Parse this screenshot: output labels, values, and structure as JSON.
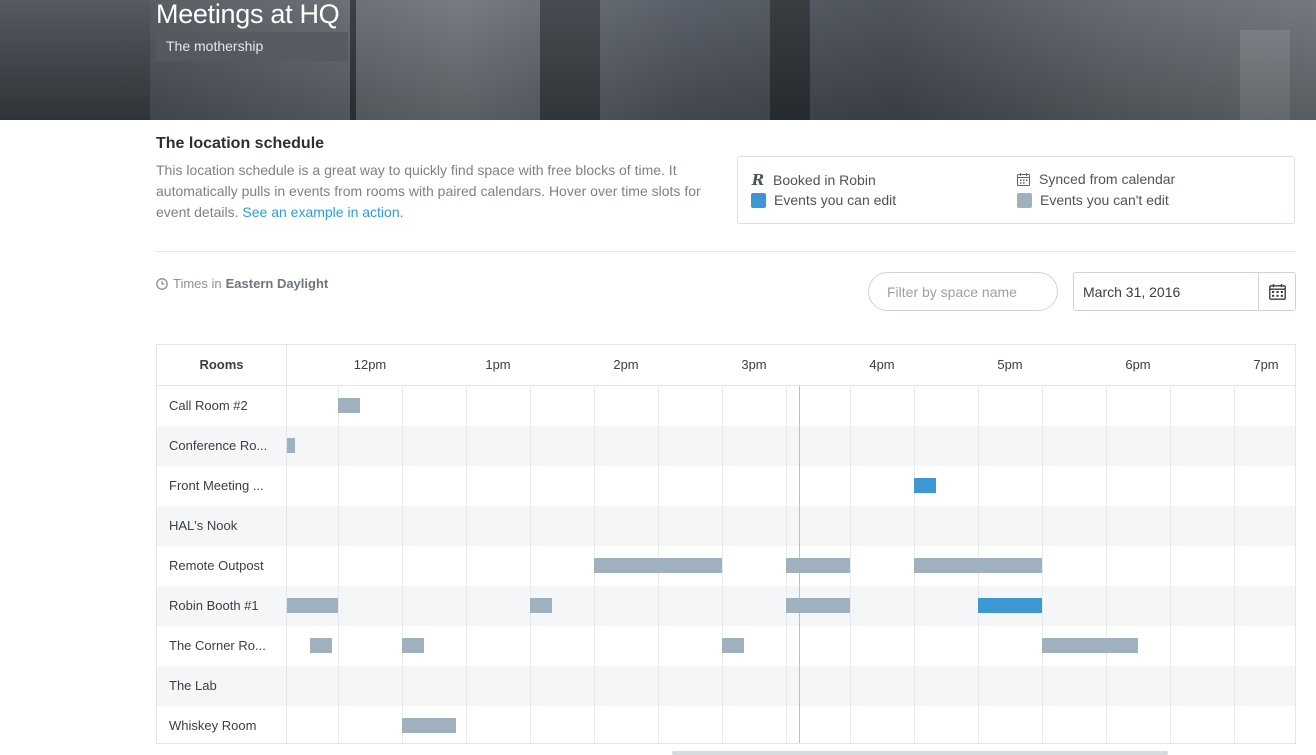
{
  "hero": {
    "title": "Meetings at HQ",
    "subtitle": "The mothership"
  },
  "intro": {
    "title": "The location schedule",
    "text": "This location schedule is a great way to quickly find space with free blocks of time. It automatically pulls in events from rooms with paired calendars. Hover over time slots for event details.",
    "link": "See an example in action."
  },
  "legend": {
    "booked": "Booked in Robin",
    "synced": "Synced from calendar",
    "editable": "Events you can edit",
    "noneditable": "Events you can't edit",
    "colors": {
      "editable": "#3d97d3",
      "noneditable": "#9fb0bf"
    }
  },
  "controls": {
    "tz_prefix": "Times in",
    "tz_name": "Eastern Daylight",
    "filter_placeholder": "Filter by space name",
    "date_value": "March 31, 2016"
  },
  "schedule": {
    "rooms_header": "Rooms",
    "start_hour": 11.6,
    "end_hour": 19.5,
    "now_hour": 15.6,
    "hours": [
      {
        "label": "12pm",
        "hour": 12
      },
      {
        "label": "1pm",
        "hour": 13
      },
      {
        "label": "2pm",
        "hour": 14
      },
      {
        "label": "3pm",
        "hour": 15
      },
      {
        "label": "4pm",
        "hour": 16
      },
      {
        "label": "5pm",
        "hour": 17
      },
      {
        "label": "6pm",
        "hour": 18
      },
      {
        "label": "7pm",
        "hour": 19
      }
    ],
    "rooms": [
      {
        "name": "Call Room #2",
        "events": [
          {
            "start": 12.0,
            "end": 12.17,
            "type": "sync"
          }
        ]
      },
      {
        "name": "Conference Ro...",
        "events": [
          {
            "start": 11.6,
            "end": 11.66,
            "type": "sync"
          }
        ]
      },
      {
        "name": "Front Meeting ...",
        "events": [
          {
            "start": 16.5,
            "end": 16.67,
            "type": "edit"
          }
        ]
      },
      {
        "name": "HAL's Nook",
        "events": []
      },
      {
        "name": "Remote Outpost",
        "events": [
          {
            "start": 14.0,
            "end": 15.0,
            "type": "sync"
          },
          {
            "start": 15.5,
            "end": 16.0,
            "type": "sync"
          },
          {
            "start": 16.5,
            "end": 17.5,
            "type": "sync"
          }
        ]
      },
      {
        "name": "Robin Booth #1",
        "events": [
          {
            "start": 11.6,
            "end": 12.0,
            "type": "sync"
          },
          {
            "start": 13.5,
            "end": 13.67,
            "type": "sync"
          },
          {
            "start": 15.5,
            "end": 16.0,
            "type": "sync"
          },
          {
            "start": 17.0,
            "end": 17.5,
            "type": "edit"
          }
        ]
      },
      {
        "name": "The Corner Ro...",
        "events": [
          {
            "start": 11.78,
            "end": 11.95,
            "type": "sync"
          },
          {
            "start": 12.5,
            "end": 12.67,
            "type": "sync"
          },
          {
            "start": 15.0,
            "end": 15.17,
            "type": "sync"
          },
          {
            "start": 17.5,
            "end": 18.25,
            "type": "sync"
          }
        ]
      },
      {
        "name": "The Lab",
        "events": []
      },
      {
        "name": "Whiskey Room",
        "events": [
          {
            "start": 12.5,
            "end": 12.92,
            "type": "sync"
          }
        ]
      }
    ]
  }
}
